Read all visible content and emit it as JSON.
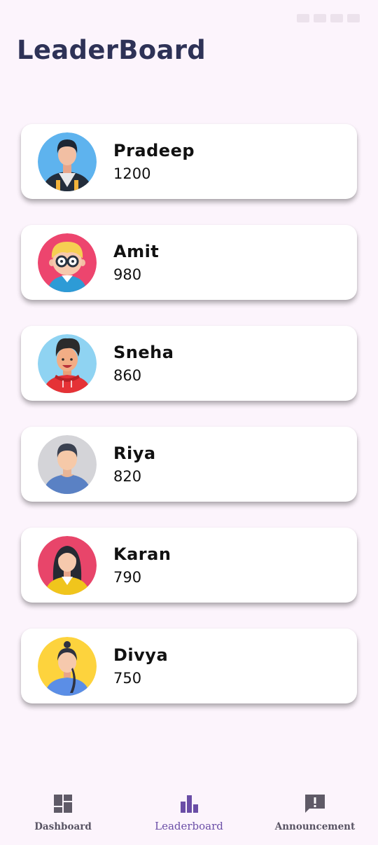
{
  "header": {
    "title": "LeaderBoard"
  },
  "leaderboard": [
    {
      "name": "Pradeep",
      "score": "1200"
    },
    {
      "name": "Amit",
      "score": "980"
    },
    {
      "name": "Sneha",
      "score": "860"
    },
    {
      "name": "Riya",
      "score": "820"
    },
    {
      "name": "Karan",
      "score": "790"
    },
    {
      "name": "Divya",
      "score": "750"
    }
  ],
  "nav": {
    "items": [
      {
        "label": "Dashboard",
        "icon": "dashboard-icon"
      },
      {
        "label": "Leaderboard",
        "icon": "leaderboard-icon"
      },
      {
        "label": "Announcement",
        "icon": "announcement-icon"
      }
    ],
    "active": "Leaderboard"
  },
  "colors": {
    "background": "#fcf4fc",
    "title": "#2e3257",
    "active_nav": "#6a4da6",
    "inactive_nav": "#5f5a67"
  }
}
